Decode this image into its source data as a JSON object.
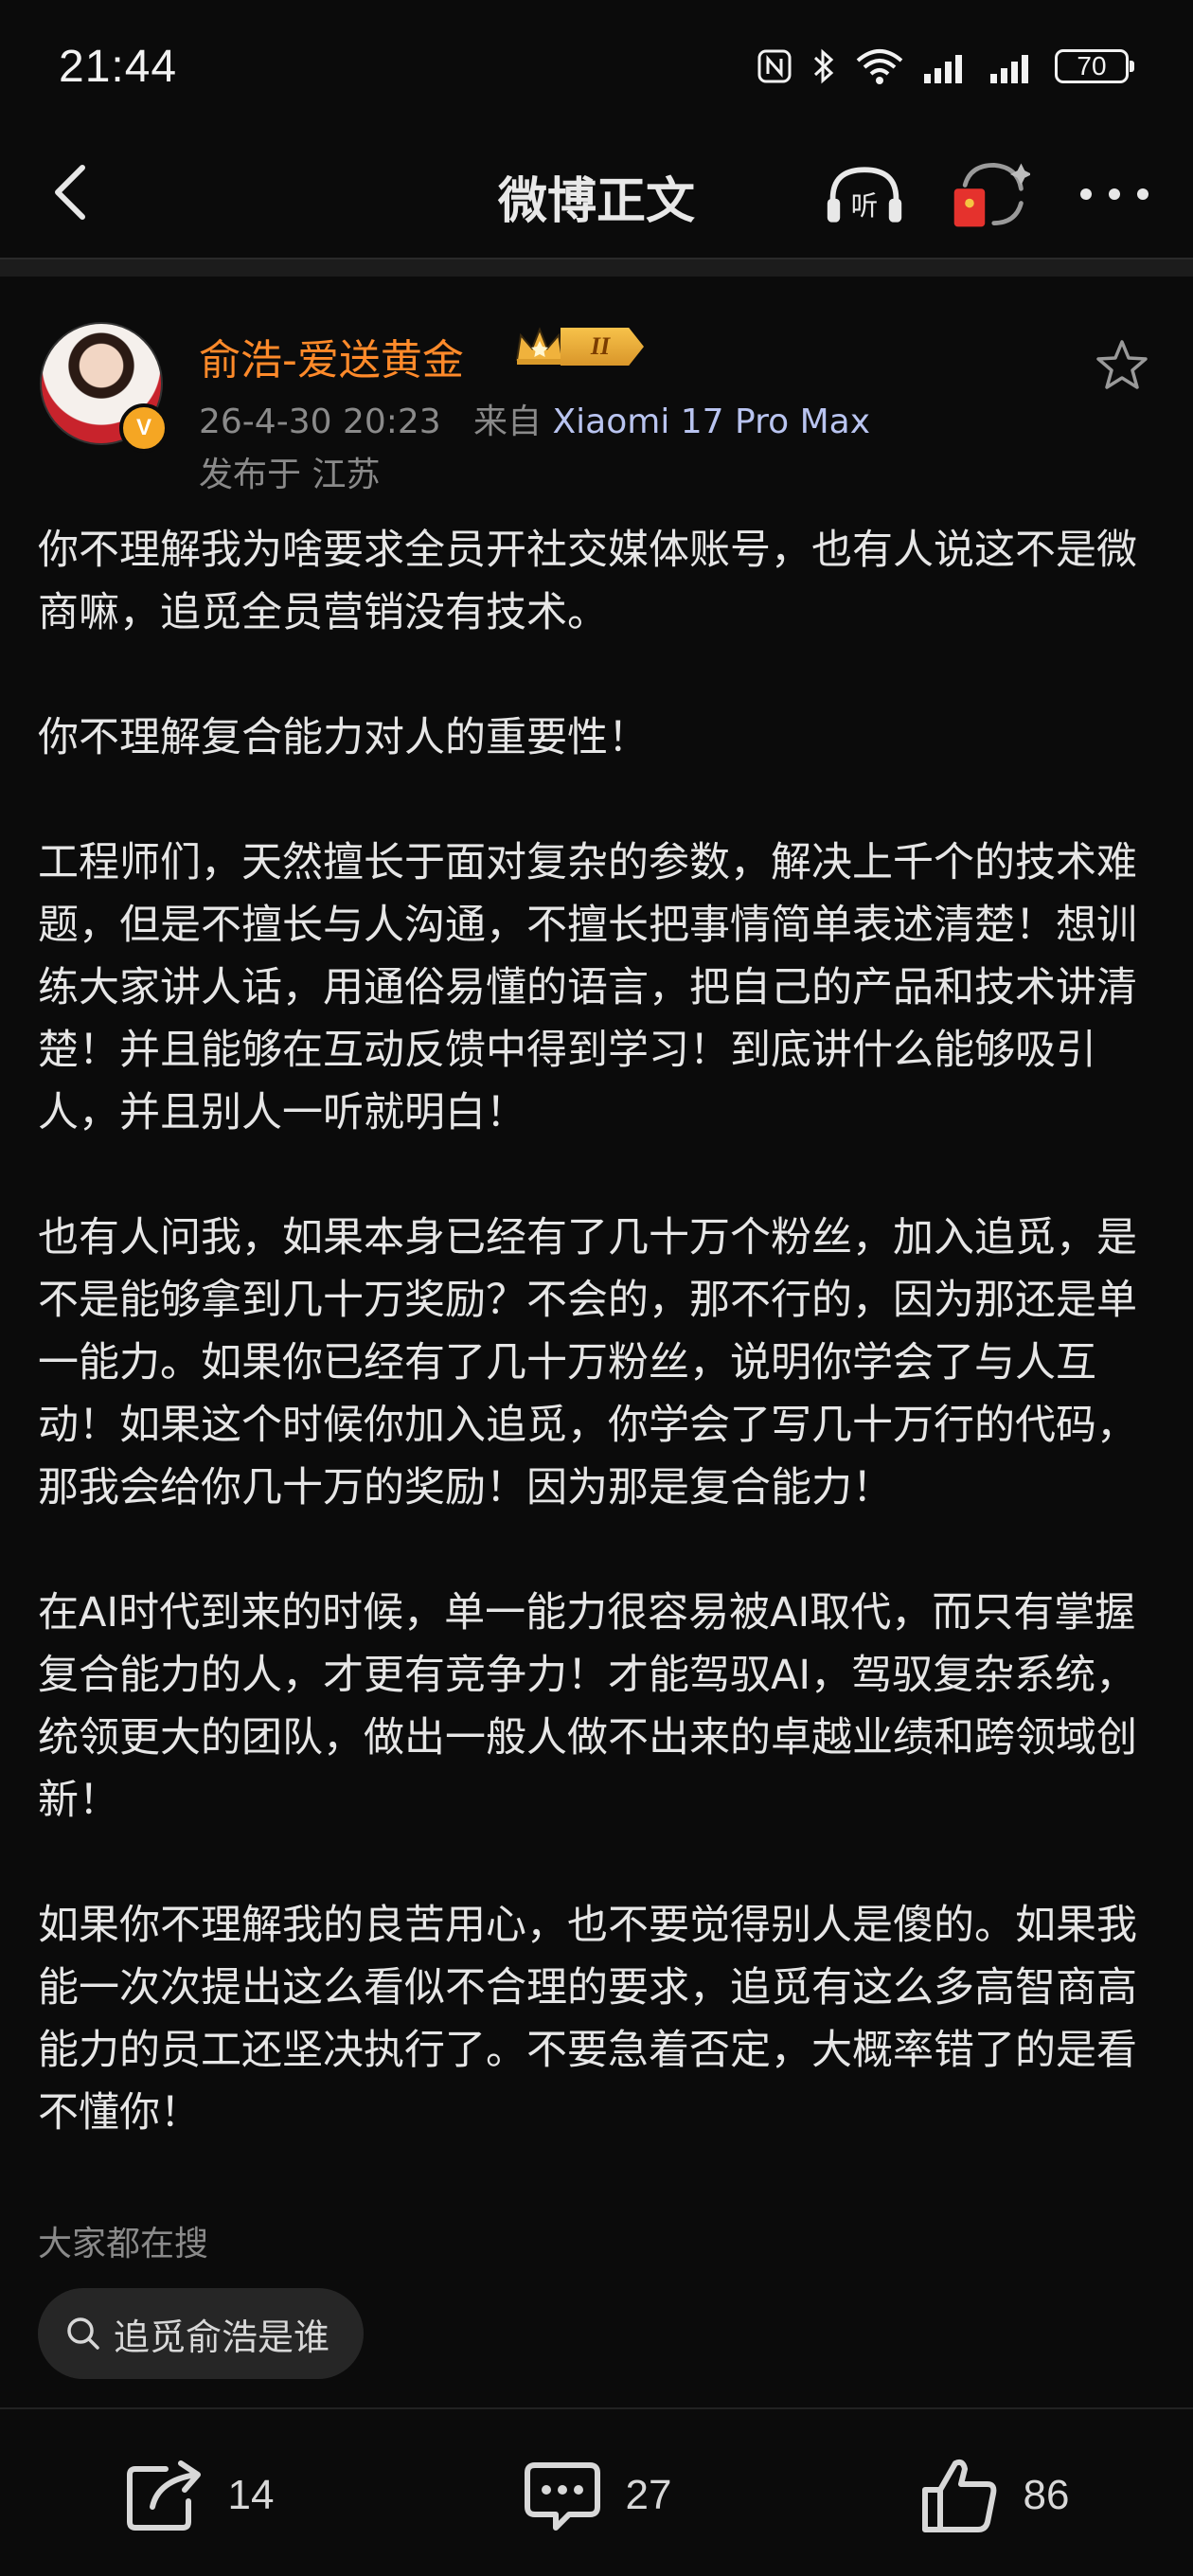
{
  "status_bar": {
    "time": "21:44",
    "battery": "70",
    "icons": [
      "nfc-icon",
      "bluetooth-icon",
      "wifi-icon",
      "signal-icon",
      "signal-icon",
      "battery-icon"
    ]
  },
  "header": {
    "title": "微博正文",
    "listen_label": "听"
  },
  "author": {
    "name": "俞浩-爱送黄金",
    "level": "II",
    "verified_mark": "V",
    "timestamp": "26-4-30 20:23",
    "from_prefix": "来自",
    "device": "Xiaomi 17 Pro Max",
    "location": "发布于 江苏"
  },
  "post": {
    "paragraphs": [
      "你不理解我为啥要求全员开社交媒体账号，也有人说这不是微商嘛，追觅全员营销没有技术。",
      "你不理解复合能力对人的重要性！",
      "工程师们，天然擅长于面对复杂的参数，解决上千个的技术难题，但是不擅长与人沟通，不擅长把事情简单表述清楚！想训练大家讲人话，用通俗易懂的语言，把自己的产品和技术讲清楚！并且能够在互动反馈中得到学习！到底讲什么能够吸引人，并且别人一听就明白！",
      "也有人问我，如果本身已经有了几十万个粉丝，加入追觅，是不是能够拿到几十万奖励？不会的，那不行的，因为那还是单一能力。如果你已经有了几十万粉丝，说明你学会了与人互动！如果这个时候你加入追觅，你学会了写几十万行的代码，那我会给你几十万的奖励！因为那是复合能力！",
      "在AI时代到来的时候，单一能力很容易被AI取代，而只有掌握复合能力的人，才更有竞争力！才能驾驭AI，驾驭复杂系统，统领更大的团队，做出一般人做不出来的卓越业绩和跨领域创新！",
      "如果你不理解我的良苦用心，也不要觉得别人是傻的。如果我能一次次提出这么看似不合理的要求，追觅有这么多高智商高能力的员工还坚决执行了。不要急着否定，大概率错了的是看不懂你！"
    ]
  },
  "trending": {
    "label": "大家都在搜",
    "chip": "追觅俞浩是谁"
  },
  "actions": {
    "repost_count": "14",
    "comment_count": "27",
    "like_count": "86"
  },
  "colors": {
    "background": "#0b0b0b",
    "author_name": "#ff8a2a",
    "device": "#b9c4f0",
    "muted": "#8a8a8a"
  }
}
